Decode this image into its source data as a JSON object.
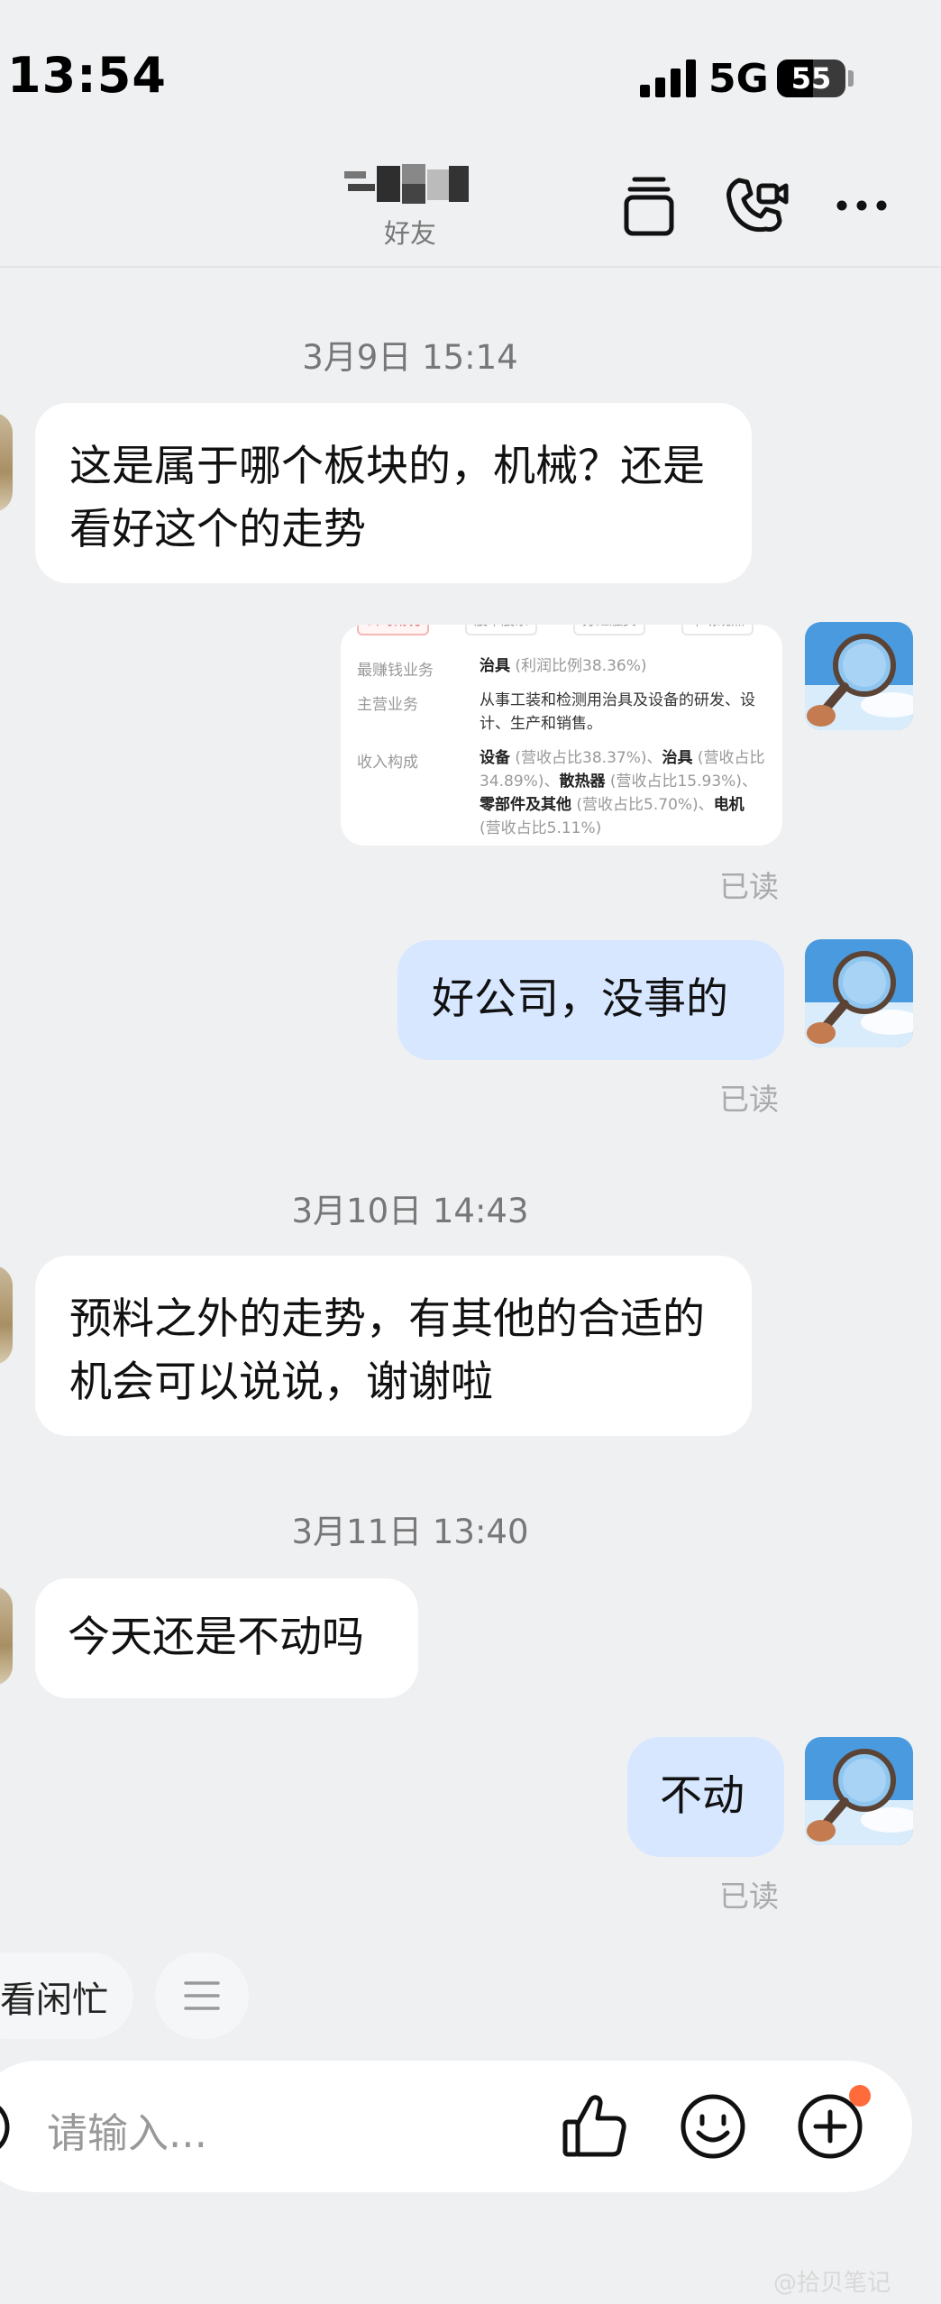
{
  "status_bar": {
    "time": "13:54",
    "network": "5G",
    "battery": "55"
  },
  "header": {
    "subtitle": "好友"
  },
  "messages": [
    {
      "timestamp": "3月9日 15:14"
    },
    {
      "text": "这是属于哪个板块的，机械？还是看好这个的走势"
    },
    {
      "card": {
        "tabs": [
          "公司概况",
          "股本股东",
          "分红融资",
          "市场观点"
        ],
        "rows": [
          {
            "label": "最赚钱业务",
            "value": "治具",
            "note": "(利润比例38.36%)"
          },
          {
            "label": "主营业务",
            "value": "从事工装和检测用治具及设备的研发、设计、生产和销售。"
          },
          {
            "label": "收入构成",
            "p1": "设备",
            "n1": "(营收占比38.37%)、",
            "p2": "治具",
            "n2": "(营收占比34.89%)、",
            "p3": "散热器",
            "n3": "(营收占比15.93%)、",
            "p4": "零部件及其他",
            "n4": "(营收占比5.70%)、",
            "p5": "电机",
            "n5": "(营收占比5.11%)"
          }
        ]
      },
      "read": "已读"
    },
    {
      "text": "好公司，没事的",
      "read": "已读"
    },
    {
      "timestamp": "3月10日 14:43"
    },
    {
      "text": "预料之外的走势，有其他的合适的机会可以说说，谢谢啦"
    },
    {
      "timestamp": "3月11日 13:40"
    },
    {
      "text": "今天还是不动吗"
    },
    {
      "text": "不动",
      "read": "已读"
    }
  ],
  "chips": {
    "status_chip": "看闲忙"
  },
  "input": {
    "placeholder": "请输入..."
  },
  "watermark": "@拾贝笔记"
}
